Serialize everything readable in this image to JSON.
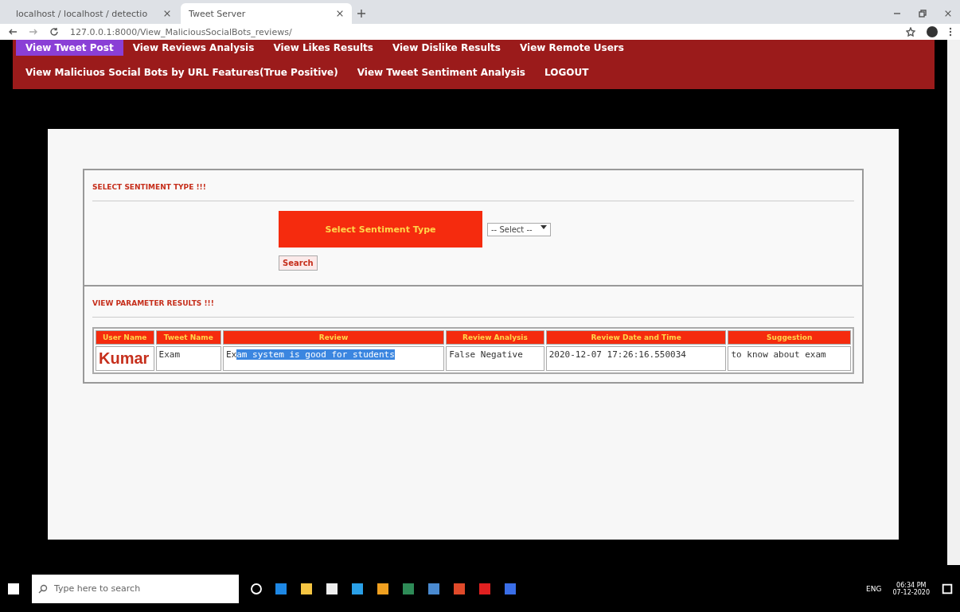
{
  "browser": {
    "tabs": [
      {
        "title": "localhost / localhost / detectio",
        "selected": false
      },
      {
        "title": "Tweet Server",
        "selected": true
      }
    ],
    "url": "127.0.0.1:8000/View_MaliciousSocialBots_reviews/"
  },
  "nav": {
    "rows": [
      {
        "links": [
          {
            "label": "View Tweet Post",
            "selected": true
          },
          {
            "label": "View Reviews Analysis",
            "selected": false
          },
          {
            "label": "View Likes Results",
            "selected": false
          },
          {
            "label": "View Dislike Results",
            "selected": false
          },
          {
            "label": "View Remote Users",
            "selected": false
          }
        ]
      },
      {
        "links": [
          {
            "label": "View Maliciuos Social Bots by URL Features(True Positive)",
            "selected": false
          },
          {
            "label": "View Tweet Sentiment Analysis",
            "selected": false
          },
          {
            "label": "LOGOUT",
            "selected": false
          }
        ]
      }
    ]
  },
  "select_section": {
    "heading": "SELECT SENTIMENT TYPE !!!",
    "label": "Select Sentiment Type",
    "dropdown": "-- Select --",
    "button": "Search"
  },
  "results": {
    "heading": "VIEW PARAMETER RESULTS !!!",
    "columns": [
      "User Name",
      "Tweet Name",
      "Review",
      "Review Analysis",
      "Review Date and Time",
      "Suggestion"
    ],
    "rows": [
      {
        "user": "Kumar",
        "tweet": "Exam",
        "review": {
          "plain": "Ex",
          "selected": "am system is good for students"
        },
        "analysis": "False Negative",
        "date": "2020-12-07 17:26:16.550034",
        "suggestion": "to know about exam"
      }
    ]
  },
  "taskbar": {
    "search_placeholder": "Type here to search",
    "language": "ENG",
    "time": "06:34 PM",
    "date": "07-12-2020"
  }
}
